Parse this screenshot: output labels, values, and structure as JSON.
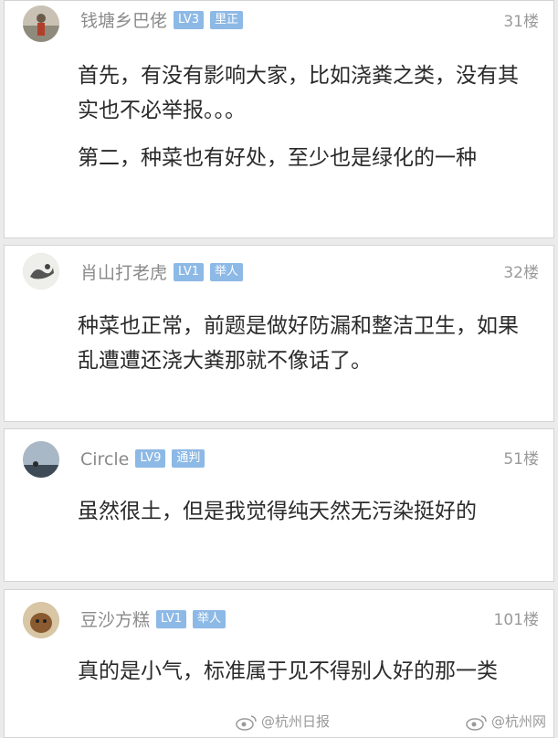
{
  "comments": [
    {
      "username": "钱塘乡巴佬",
      "level": "LV3",
      "title": "里正",
      "floor": "31楼",
      "paragraphs": [
        "首先，有没有影响大家，比如浇粪之类，没有其实也不必举报。。。",
        "第二，种菜也有好处，至少也是绿化的一种"
      ]
    },
    {
      "username": "肖山打老虎",
      "level": "LV1",
      "title": "举人",
      "floor": "32楼",
      "paragraphs": [
        "种菜也正常，前题是做好防漏和整洁卫生，如果乱遭遭还浇大粪那就不像话了。"
      ]
    },
    {
      "username": "Circle",
      "level": "LV9",
      "title": "通判",
      "floor": "51楼",
      "paragraphs": [
        "虽然很土，但是我觉得纯天然无污染挺好的"
      ]
    },
    {
      "username": "豆沙方糕",
      "level": "LV1",
      "title": "举人",
      "floor": "101楼",
      "paragraphs": [
        "真的是小气，标准属于见不得别人好的那一类"
      ]
    }
  ],
  "watermarks": [
    "@杭州日报",
    "@杭州网"
  ],
  "colors": {
    "badge": "#8db9e6",
    "username": "#8a8a8a",
    "body_text": "#2a2a2a"
  }
}
